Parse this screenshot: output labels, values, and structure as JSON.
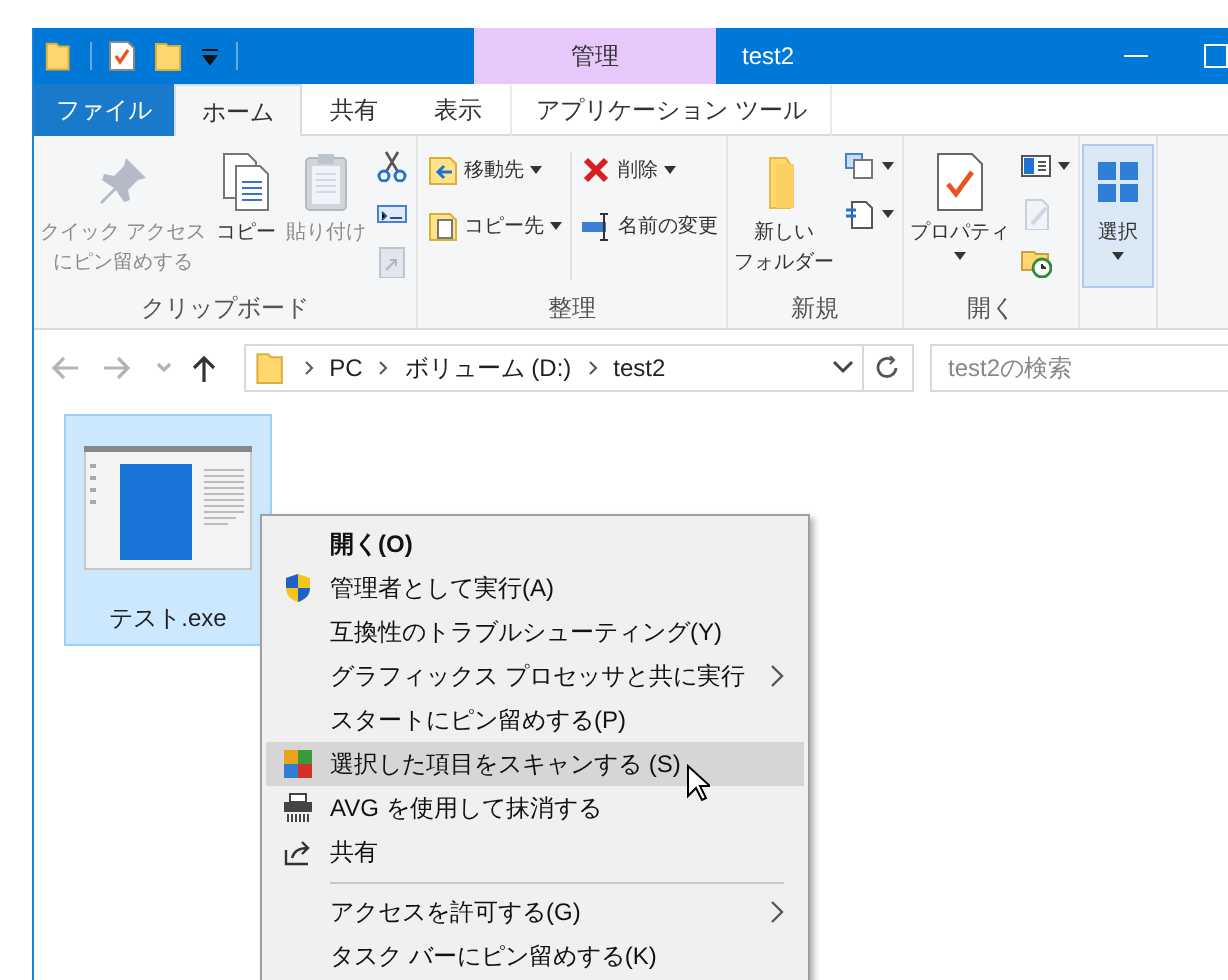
{
  "window": {
    "title": "test2",
    "context_header": "管理"
  },
  "ribbon_tabs": [
    {
      "label": "ファイル",
      "kind": "file",
      "selected": false
    },
    {
      "label": "ホーム",
      "kind": "tab",
      "selected": true
    },
    {
      "label": "共有",
      "kind": "tab",
      "selected": false
    },
    {
      "label": "表示",
      "kind": "tab",
      "selected": false
    },
    {
      "label": "アプリケーション ツール",
      "kind": "contextual",
      "selected": false
    }
  ],
  "ribbon_groups": [
    {
      "label": "クリップボード",
      "columns": [
        [
          {
            "kind": "large",
            "label_lines": [
              "クイック アクセス",
              "にピン留めする"
            ],
            "disabled": true,
            "dropdown": false
          }
        ],
        [
          {
            "kind": "large",
            "label_lines": [
              "コピー"
            ],
            "disabled": false,
            "dropdown": false
          }
        ],
        [
          {
            "kind": "large",
            "label_lines": [
              "貼り付け"
            ],
            "disabled": true,
            "dropdown": false
          }
        ],
        [
          {
            "kind": "icon",
            "disabled": false,
            "dropdown": false
          },
          {
            "kind": "icon",
            "disabled": false,
            "dropdown": false
          },
          {
            "kind": "icon",
            "disabled": true,
            "dropdown": false
          }
        ]
      ]
    },
    {
      "label": "整理",
      "columns": [
        [
          {
            "kind": "small",
            "label_lines": [
              "移動先"
            ],
            "disabled": false,
            "dropdown": true
          },
          {
            "kind": "small",
            "label_lines": [
              "コピー先"
            ],
            "disabled": false,
            "dropdown": true
          }
        ],
        [
          {
            "kind": "small",
            "label_lines": [
              "削除"
            ],
            "disabled": false,
            "dropdown": true
          },
          {
            "kind": "small",
            "label_lines": [
              "名前の変更"
            ],
            "disabled": false,
            "dropdown": false
          }
        ]
      ]
    },
    {
      "label": "新規",
      "columns": [
        [
          {
            "kind": "large",
            "label_lines": [
              "新しい",
              "フォルダー"
            ],
            "disabled": false,
            "dropdown": false
          }
        ],
        [
          {
            "kind": "icon",
            "disabled": false,
            "dropdown": true
          },
          {
            "kind": "icon",
            "disabled": false,
            "dropdown": true
          }
        ]
      ]
    },
    {
      "label": "開く",
      "columns": [
        [
          {
            "kind": "large",
            "label_lines": [
              "プロパティ"
            ],
            "disabled": false,
            "dropdown": true
          }
        ],
        [
          {
            "kind": "icon",
            "disabled": false,
            "dropdown": true
          },
          {
            "kind": "icon",
            "disabled": true,
            "dropdown": false
          },
          {
            "kind": "icon",
            "disabled": false,
            "dropdown": false
          }
        ]
      ]
    },
    {
      "columns": [
        [
          {
            "kind": "large",
            "label_lines": [
              "選択"
            ],
            "disabled": false,
            "dropdown": true
          }
        ]
      ]
    }
  ],
  "nav_buttons": [
    {
      "kind": "back",
      "disabled": true
    },
    {
      "kind": "forward",
      "disabled": true
    },
    {
      "kind": "recent",
      "disabled": true
    },
    {
      "kind": "up",
      "disabled": false
    }
  ],
  "address": {
    "path": [
      "PC",
      "ボリューム (D:)",
      "test2"
    ]
  },
  "search": {
    "placeholder": "test2の検索"
  },
  "files": [
    {
      "name": "テスト.exe",
      "selected": true
    }
  ],
  "context_menu": [
    {
      "kind": "plain",
      "label": "開く(O)",
      "bold": true,
      "submenu": false,
      "selected": false
    },
    {
      "kind": "shield",
      "label": "管理者として実行(A)",
      "bold": false,
      "submenu": false,
      "selected": false
    },
    {
      "kind": "plain",
      "label": "互換性のトラブルシューティング(Y)",
      "bold": false,
      "submenu": false,
      "selected": false
    },
    {
      "kind": "plain",
      "label": "グラフィックス プロセッサと共に実行",
      "bold": false,
      "submenu": true,
      "selected": false
    },
    {
      "kind": "plain",
      "label": "スタートにピン留めする(P)",
      "bold": false,
      "submenu": false,
      "selected": false
    },
    {
      "kind": "scan",
      "label": "選択した項目をスキャンする (S)",
      "bold": false,
      "submenu": false,
      "selected": true
    },
    {
      "kind": "shredder",
      "label": "AVG を使用して抹消する",
      "bold": false,
      "submenu": false,
      "selected": false
    },
    {
      "kind": "share",
      "label": "共有",
      "bold": false,
      "submenu": false,
      "selected": false
    },
    {
      "kind": "separator"
    },
    {
      "kind": "plain",
      "label": "アクセスを許可する(G)",
      "bold": false,
      "submenu": true,
      "selected": false
    },
    {
      "kind": "plain",
      "label": "タスク バーにピン留めする(K)",
      "bold": false,
      "submenu": false,
      "selected": false
    }
  ]
}
